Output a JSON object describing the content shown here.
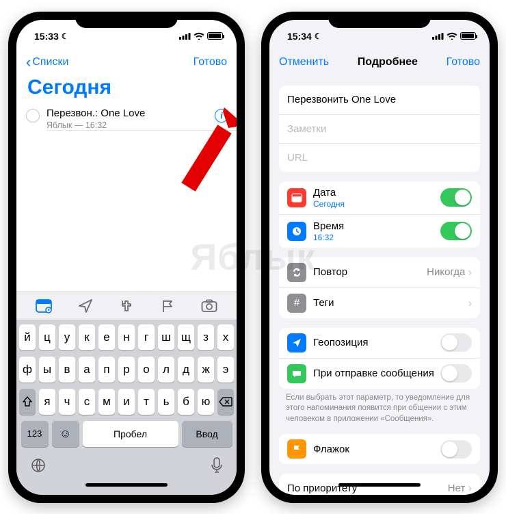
{
  "watermark": "Яблык",
  "status": {
    "time_left": "15:33",
    "time_right": "15:34"
  },
  "left": {
    "nav_back": "Списки",
    "nav_done": "Готово",
    "page_title": "Сегодня",
    "reminder_title": "Перезвон.: One Love",
    "reminder_sub": "Яблык — 16:32",
    "quickbar": [
      "calendar",
      "location",
      "tag",
      "flag",
      "camera"
    ],
    "keyboard": {
      "row1": [
        "й",
        "ц",
        "у",
        "к",
        "е",
        "н",
        "г",
        "ш",
        "щ",
        "з",
        "х"
      ],
      "row2": [
        "ф",
        "ы",
        "в",
        "а",
        "п",
        "р",
        "о",
        "л",
        "д",
        "ж",
        "э"
      ],
      "row3": [
        "я",
        "ч",
        "с",
        "м",
        "и",
        "т",
        "ь",
        "б",
        "ю"
      ],
      "space": "Пробел",
      "enter": "Ввод",
      "numbers": "123"
    }
  },
  "right": {
    "nav_cancel": "Отменить",
    "nav_title": "Подробнее",
    "nav_done": "Готово",
    "field_title": "Перезвонить One Love",
    "placeholder_notes": "Заметки",
    "placeholder_url": "URL",
    "date_label": "Дата",
    "date_value": "Сегодня",
    "time_label": "Время",
    "time_value": "16:32",
    "repeat_label": "Повтор",
    "repeat_value": "Никогда",
    "tags_label": "Теги",
    "location_label": "Геопозиция",
    "messaging_label": "При отправке сообщения",
    "messaging_footnote": "Если выбрать этот параметр, то уведомление для этого напоминания появится при общении с этим человеком в приложении «Сообщения».",
    "flag_label": "Флажок",
    "priority_label": "По приоритету",
    "priority_value": "Нет"
  }
}
